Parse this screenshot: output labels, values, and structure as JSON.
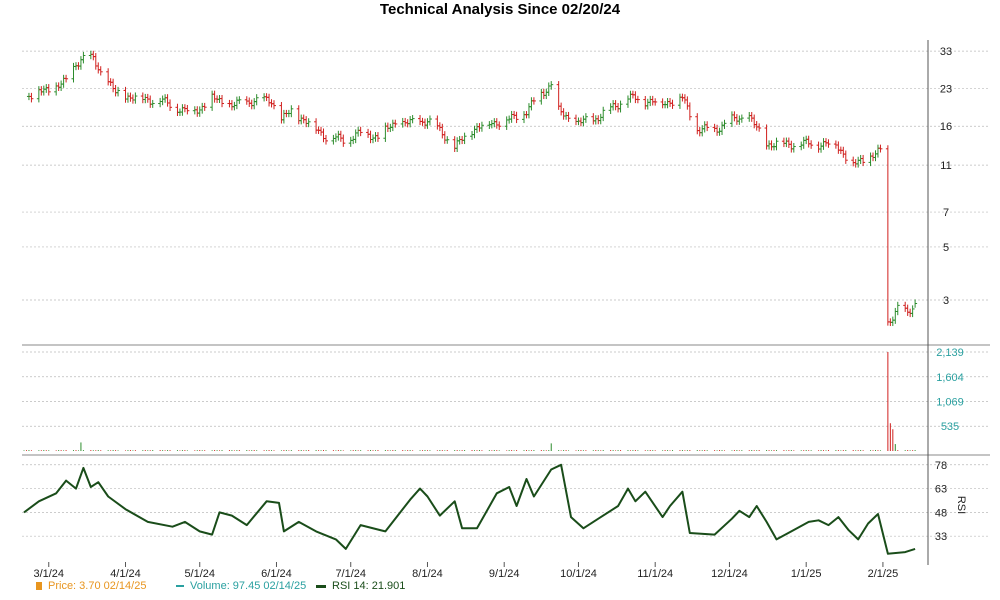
{
  "chart_data": {
    "type": "line",
    "title": "Technical Analysis Since 02/20/24",
    "price_panel": {
      "type": "ohlc",
      "scale": "log",
      "y_ticks": [
        3,
        5,
        7,
        11,
        16,
        23,
        33
      ],
      "ylim": [
        2.1,
        34
      ],
      "series": [
        {
          "date": "2024-02-22",
          "price": 21.5
        },
        {
          "date": "2024-03-01",
          "price": 22.8
        },
        {
          "date": "2024-03-08",
          "price": 24.5
        },
        {
          "date": "2024-03-12",
          "price": 29.5
        },
        {
          "date": "2024-03-15",
          "price": 31.0
        },
        {
          "date": "2024-03-19",
          "price": 30.5
        },
        {
          "date": "2024-03-22",
          "price": 27.0
        },
        {
          "date": "2024-03-28",
          "price": 22.0
        },
        {
          "date": "2024-04-05",
          "price": 21.0
        },
        {
          "date": "2024-04-15",
          "price": 20.5
        },
        {
          "date": "2024-04-25",
          "price": 18.5
        },
        {
          "date": "2024-05-01",
          "price": 19.0
        },
        {
          "date": "2024-05-06",
          "price": 21.0
        },
        {
          "date": "2024-05-14",
          "price": 19.5
        },
        {
          "date": "2024-05-22",
          "price": 20.5
        },
        {
          "date": "2024-05-30",
          "price": 20.5
        },
        {
          "date": "2024-06-03",
          "price": 17.0
        },
        {
          "date": "2024-06-07",
          "price": 18.5
        },
        {
          "date": "2024-06-14",
          "price": 16.5
        },
        {
          "date": "2024-06-21",
          "price": 14.5
        },
        {
          "date": "2024-06-28",
          "price": 14.0
        },
        {
          "date": "2024-07-05",
          "price": 15.0
        },
        {
          "date": "2024-07-12",
          "price": 14.5
        },
        {
          "date": "2024-07-19",
          "price": 16.5
        },
        {
          "date": "2024-07-26",
          "price": 16.5
        },
        {
          "date": "2024-08-01",
          "price": 17.0
        },
        {
          "date": "2024-08-07",
          "price": 15.0
        },
        {
          "date": "2024-08-12",
          "price": 13.0
        },
        {
          "date": "2024-08-19",
          "price": 15.5
        },
        {
          "date": "2024-08-26",
          "price": 16.5
        },
        {
          "date": "2024-09-03",
          "price": 17.0
        },
        {
          "date": "2024-09-10",
          "price": 18.5
        },
        {
          "date": "2024-09-16",
          "price": 22.0
        },
        {
          "date": "2024-09-20",
          "price": 24.0
        },
        {
          "date": "2024-09-23",
          "price": 18.5
        },
        {
          "date": "2024-09-30",
          "price": 16.5
        },
        {
          "date": "2024-10-07",
          "price": 17.0
        },
        {
          "date": "2024-10-14",
          "price": 19.0
        },
        {
          "date": "2024-10-21",
          "price": 21.0
        },
        {
          "date": "2024-10-28",
          "price": 20.5
        },
        {
          "date": "2024-11-04",
          "price": 20.0
        },
        {
          "date": "2024-11-12",
          "price": 21.0
        },
        {
          "date": "2024-11-18",
          "price": 15.5
        },
        {
          "date": "2024-11-25",
          "price": 15.5
        },
        {
          "date": "2024-12-02",
          "price": 17.0
        },
        {
          "date": "2024-12-09",
          "price": 17.5
        },
        {
          "date": "2024-12-16",
          "price": 13.5
        },
        {
          "date": "2024-12-23",
          "price": 13.5
        },
        {
          "date": "2024-12-30",
          "price": 13.5
        },
        {
          "date": "2025-01-06",
          "price": 13.5
        },
        {
          "date": "2025-01-13",
          "price": 13.5
        },
        {
          "date": "2025-01-20",
          "price": 11.0
        },
        {
          "date": "2025-01-27",
          "price": 12.0
        },
        {
          "date": "2025-01-31",
          "price": 12.5
        },
        {
          "date": "2025-02-03",
          "price": 2.4
        },
        {
          "date": "2025-02-07",
          "price": 2.8
        },
        {
          "date": "2025-02-11",
          "price": 2.6
        },
        {
          "date": "2025-02-14",
          "price": 2.9
        }
      ]
    },
    "volume_panel": {
      "type": "bar",
      "y_ticks": [
        535,
        1069,
        1604,
        2139
      ],
      "ylim": [
        0,
        2139
      ],
      "spikes": [
        {
          "date": "2024-03-14",
          "volume": 185,
          "dir": "up"
        },
        {
          "date": "2024-09-20",
          "volume": 165,
          "dir": "up"
        },
        {
          "date": "2025-02-03",
          "volume": 2139,
          "dir": "down"
        },
        {
          "date": "2025-02-04",
          "volume": 600,
          "dir": "down"
        },
        {
          "date": "2025-02-05",
          "volume": 470,
          "dir": "down"
        },
        {
          "date": "2025-02-06",
          "volume": 150,
          "dir": "up"
        }
      ],
      "baseline_volume": 20
    },
    "rsi_panel": {
      "type": "line",
      "ylabel": "RSI",
      "y_ticks": [
        33,
        48,
        63,
        78
      ],
      "ylim": [
        18,
        81
      ],
      "series": [
        {
          "date": "2024-02-20",
          "value": 48
        },
        {
          "date": "2024-02-26",
          "value": 55
        },
        {
          "date": "2024-03-04",
          "value": 60
        },
        {
          "date": "2024-03-08",
          "value": 68
        },
        {
          "date": "2024-03-12",
          "value": 63
        },
        {
          "date": "2024-03-15",
          "value": 76
        },
        {
          "date": "2024-03-18",
          "value": 64
        },
        {
          "date": "2024-03-21",
          "value": 67
        },
        {
          "date": "2024-03-25",
          "value": 58
        },
        {
          "date": "2024-04-01",
          "value": 50
        },
        {
          "date": "2024-04-10",
          "value": 42
        },
        {
          "date": "2024-04-20",
          "value": 39
        },
        {
          "date": "2024-04-25",
          "value": 42
        },
        {
          "date": "2024-05-01",
          "value": 36
        },
        {
          "date": "2024-05-06",
          "value": 34
        },
        {
          "date": "2024-05-09",
          "value": 48
        },
        {
          "date": "2024-05-14",
          "value": 46
        },
        {
          "date": "2024-05-20",
          "value": 40
        },
        {
          "date": "2024-05-28",
          "value": 55
        },
        {
          "date": "2024-06-02",
          "value": 54
        },
        {
          "date": "2024-06-04",
          "value": 36
        },
        {
          "date": "2024-06-10",
          "value": 42
        },
        {
          "date": "2024-06-17",
          "value": 36
        },
        {
          "date": "2024-06-25",
          "value": 31
        },
        {
          "date": "2024-06-29",
          "value": 25
        },
        {
          "date": "2024-07-05",
          "value": 40
        },
        {
          "date": "2024-07-15",
          "value": 36
        },
        {
          "date": "2024-07-25",
          "value": 56
        },
        {
          "date": "2024-07-29",
          "value": 63
        },
        {
          "date": "2024-08-01",
          "value": 58
        },
        {
          "date": "2024-08-06",
          "value": 46
        },
        {
          "date": "2024-08-12",
          "value": 55
        },
        {
          "date": "2024-08-15",
          "value": 38
        },
        {
          "date": "2024-08-21",
          "value": 38
        },
        {
          "date": "2024-08-29",
          "value": 60
        },
        {
          "date": "2024-09-03",
          "value": 64
        },
        {
          "date": "2024-09-06",
          "value": 52
        },
        {
          "date": "2024-09-10",
          "value": 69
        },
        {
          "date": "2024-09-13",
          "value": 58
        },
        {
          "date": "2024-09-20",
          "value": 75
        },
        {
          "date": "2024-09-24",
          "value": 78
        },
        {
          "date": "2024-09-28",
          "value": 45
        },
        {
          "date": "2024-10-03",
          "value": 38
        },
        {
          "date": "2024-10-09",
          "value": 44
        },
        {
          "date": "2024-10-17",
          "value": 52
        },
        {
          "date": "2024-10-21",
          "value": 63
        },
        {
          "date": "2024-10-24",
          "value": 55
        },
        {
          "date": "2024-10-28",
          "value": 61
        },
        {
          "date": "2024-11-04",
          "value": 45
        },
        {
          "date": "2024-11-07",
          "value": 52
        },
        {
          "date": "2024-11-12",
          "value": 61
        },
        {
          "date": "2024-11-15",
          "value": 35
        },
        {
          "date": "2024-11-25",
          "value": 34
        },
        {
          "date": "2024-12-02",
          "value": 44
        },
        {
          "date": "2024-12-05",
          "value": 49
        },
        {
          "date": "2024-12-09",
          "value": 45
        },
        {
          "date": "2024-12-12",
          "value": 52
        },
        {
          "date": "2024-12-16",
          "value": 42
        },
        {
          "date": "2024-12-20",
          "value": 31
        },
        {
          "date": "2024-12-26",
          "value": 36
        },
        {
          "date": "2025-01-02",
          "value": 42
        },
        {
          "date": "2025-01-06",
          "value": 43
        },
        {
          "date": "2025-01-10",
          "value": 40
        },
        {
          "date": "2025-01-14",
          "value": 45
        },
        {
          "date": "2025-01-18",
          "value": 37
        },
        {
          "date": "2025-01-22",
          "value": 31
        },
        {
          "date": "2025-01-26",
          "value": 41
        },
        {
          "date": "2025-01-30",
          "value": 47
        },
        {
          "date": "2025-02-03",
          "value": 22
        },
        {
          "date": "2025-02-10",
          "value": 23
        },
        {
          "date": "2025-02-14",
          "value": 25
        }
      ]
    },
    "x_ticks": [
      {
        "date": "2024-03-01",
        "label": "3/1/24"
      },
      {
        "date": "2024-04-01",
        "label": "4/1/24"
      },
      {
        "date": "2024-05-01",
        "label": "5/1/24"
      },
      {
        "date": "2024-06-01",
        "label": "6/1/24"
      },
      {
        "date": "2024-07-01",
        "label": "7/1/24"
      },
      {
        "date": "2024-08-01",
        "label": "8/1/24"
      },
      {
        "date": "2024-09-01",
        "label": "9/1/24"
      },
      {
        "date": "2024-10-01",
        "label": "10/1/24"
      },
      {
        "date": "2024-11-01",
        "label": "11/1/24"
      },
      {
        "date": "2024-12-01",
        "label": "12/1/24"
      },
      {
        "date": "2025-01-01",
        "label": "1/1/25"
      },
      {
        "date": "2025-02-01",
        "label": "2/1/25"
      }
    ],
    "x_range": [
      "2024-02-20",
      "2025-02-18"
    ],
    "legend": [
      {
        "label": "Price: 3.70  02/14/25",
        "color": "#e8951f"
      },
      {
        "label": "Volume: 97.45  02/14/25",
        "color": "#2aa0a0"
      },
      {
        "label": "RSI 14: 21.901",
        "color": "#1a4d1a"
      }
    ],
    "colors": {
      "up": "#2c8c2c",
      "down": "#d0201e",
      "rsi": "#1a4d1a",
      "grid": "#bbbbbb"
    },
    "grid": true
  }
}
